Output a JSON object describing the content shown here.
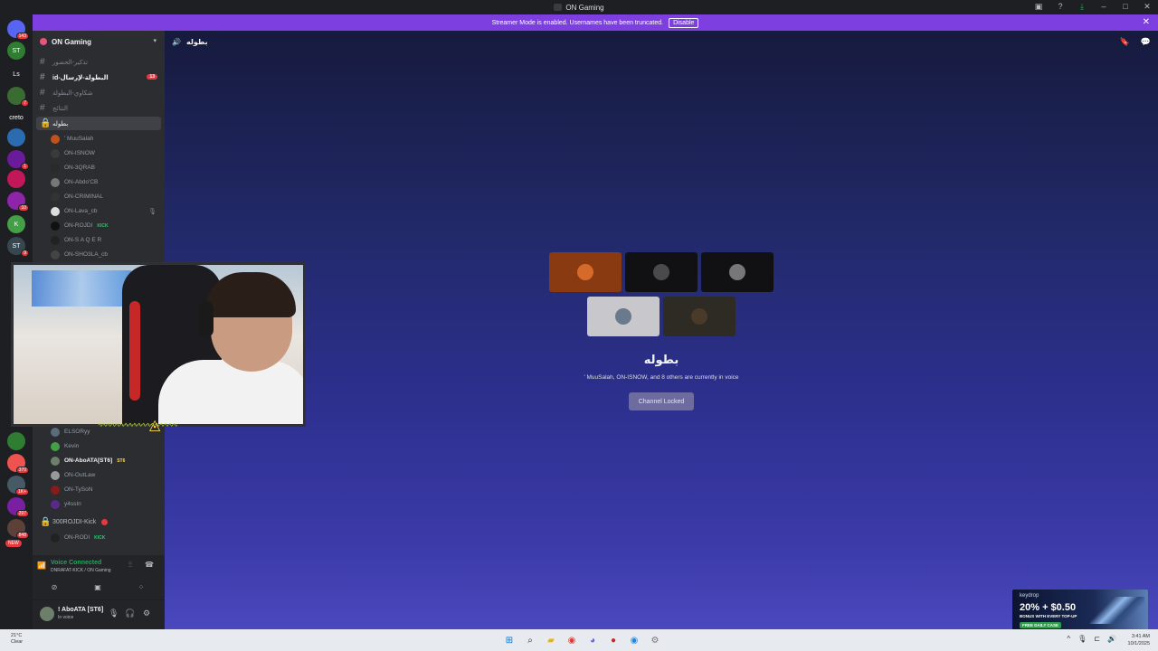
{
  "window": {
    "title": "ON Gaming"
  },
  "banner": {
    "text": "Streamer Mode is enabled. Usernames have been truncated.",
    "button": "Disable"
  },
  "rail": {
    "servers": [
      {
        "initials": "",
        "badge": "143",
        "color": "#5865f2",
        "top": 0
      },
      {
        "initials": "ST",
        "badge": "",
        "color": "#2e7d32",
        "top": 0
      },
      {
        "initials": "Ls",
        "badge": "",
        "color": "#1e1f22",
        "top": 0
      },
      {
        "initials": "",
        "badge": "7",
        "color": "#3a6b30",
        "top": 0
      },
      {
        "initials": "creto",
        "badge": "",
        "color": "#1e1f22",
        "top": 0
      },
      {
        "initials": "",
        "badge": "",
        "color": "#2b6cb0",
        "top": 0
      },
      {
        "initials": "",
        "badge": "1",
        "color": "#6a1b9a",
        "top": 0
      },
      {
        "initials": "",
        "badge": "",
        "color": "#c2185b",
        "top": 0
      },
      {
        "initials": "",
        "badge": "10",
        "color": "#8e24aa",
        "top": 0
      },
      {
        "initials": "K",
        "badge": "",
        "color": "#43a047",
        "top": 0
      },
      {
        "initials": "ST",
        "badge": "9",
        "color": "#37474f",
        "top": 0
      }
    ],
    "servers_bottom": [
      {
        "initials": "",
        "badge": "",
        "color": "#2e7d32"
      },
      {
        "initials": "",
        "badge": "370",
        "color": "#ef5350"
      },
      {
        "initials": "",
        "badge": "1K+",
        "color": "#455a64"
      },
      {
        "initials": "",
        "badge": "297",
        "color": "#7b1fa2"
      },
      {
        "initials": "",
        "badge": "848",
        "color": "#5d4037"
      }
    ],
    "new_label": "NEW"
  },
  "sidebar": {
    "guild_name": "ON Gaming",
    "channels": [
      {
        "name": "تذكير-الحضور",
        "state": "muted"
      },
      {
        "name": "id-البطولة-لإرسال",
        "state": "unread",
        "mention": "13"
      },
      {
        "name": "شكاوي-البطولة",
        "state": "muted"
      },
      {
        "name": "النتائج",
        "state": "muted"
      }
    ],
    "voice_channel": "بطوله",
    "voice_users": [
      {
        "name": "' MuuSalah",
        "tag": "",
        "color": "#c0501c"
      },
      {
        "name": "ON-ISNOW",
        "tag": "",
        "color": "#3a3a3a"
      },
      {
        "name": "ON-3QRAB",
        "tag": "",
        "color": "#2a2a2a"
      },
      {
        "name": "ON-Abdo'CB",
        "tag": "",
        "color": "#777"
      },
      {
        "name": "ON-CRIMINAL",
        "tag": "",
        "color": "#333"
      },
      {
        "name": "ON-Lava_cb",
        "tag": "",
        "color": "#ddd",
        "muted": true
      },
      {
        "name": "ON-ROJDI",
        "tag": "KICK",
        "color": "#111"
      },
      {
        "name": "ON-S A Q E R",
        "tag": "",
        "color": "#222"
      },
      {
        "name": "ON-SHO3LA_cb",
        "tag": "",
        "color": "#444"
      }
    ],
    "voice_users_2": [
      {
        "name": "ELSORyy",
        "tag": "",
        "color": "#5a6b7a"
      },
      {
        "name": "Kevin",
        "tag": "",
        "color": "#43a047"
      },
      {
        "name": "ON-AboATA[ST6]",
        "tag": "ST6",
        "color": "#6d7f6a",
        "bold": true
      },
      {
        "name": "ON-OutLaw",
        "tag": "",
        "color": "#999"
      },
      {
        "name": "ON-TySoN",
        "tag": "",
        "color": "#8b1a1a"
      },
      {
        "name": "y4ssIn",
        "tag": "",
        "color": "#5a2a8a"
      }
    ],
    "locked_channel": "300ROJDI-Kick",
    "locked_user": {
      "name": "ON-RODI",
      "tag": "KICK"
    },
    "voice": {
      "title": "Voice Connected",
      "sub": "DNRAFAT-KICK / ON Gaming"
    },
    "user": {
      "name": "! AboATA [ST6]",
      "status": "In voice"
    }
  },
  "main": {
    "channel_name": "بطوله",
    "voice_title": "بطوله",
    "description": "' MuuSalah, ON-ISNOW, and 8 others are currently in voice",
    "button": "Channel Locked",
    "tiles": [
      {
        "color": "#8a3a10",
        "avatar": "#d66a2a"
      },
      {
        "color": "#111114",
        "avatar": "#4a4a4a"
      },
      {
        "color": "#111114",
        "avatar": "#777"
      },
      {
        "color": "#c8c8cc",
        "avatar": "#6a7a8a"
      },
      {
        "color": "#2e2a24",
        "avatar": "#4a3a2a"
      }
    ]
  },
  "ad": {
    "brand": "keydrop",
    "headline": "20% + $0.50",
    "sub": "BONUS WITH EVERY TOP-UP",
    "cta": "FREE DAILY CASE"
  },
  "taskbar": {
    "weather_temp": "21°C",
    "weather_desc": "Clear",
    "time": "3:41 AM",
    "date": "10/1/2025"
  }
}
